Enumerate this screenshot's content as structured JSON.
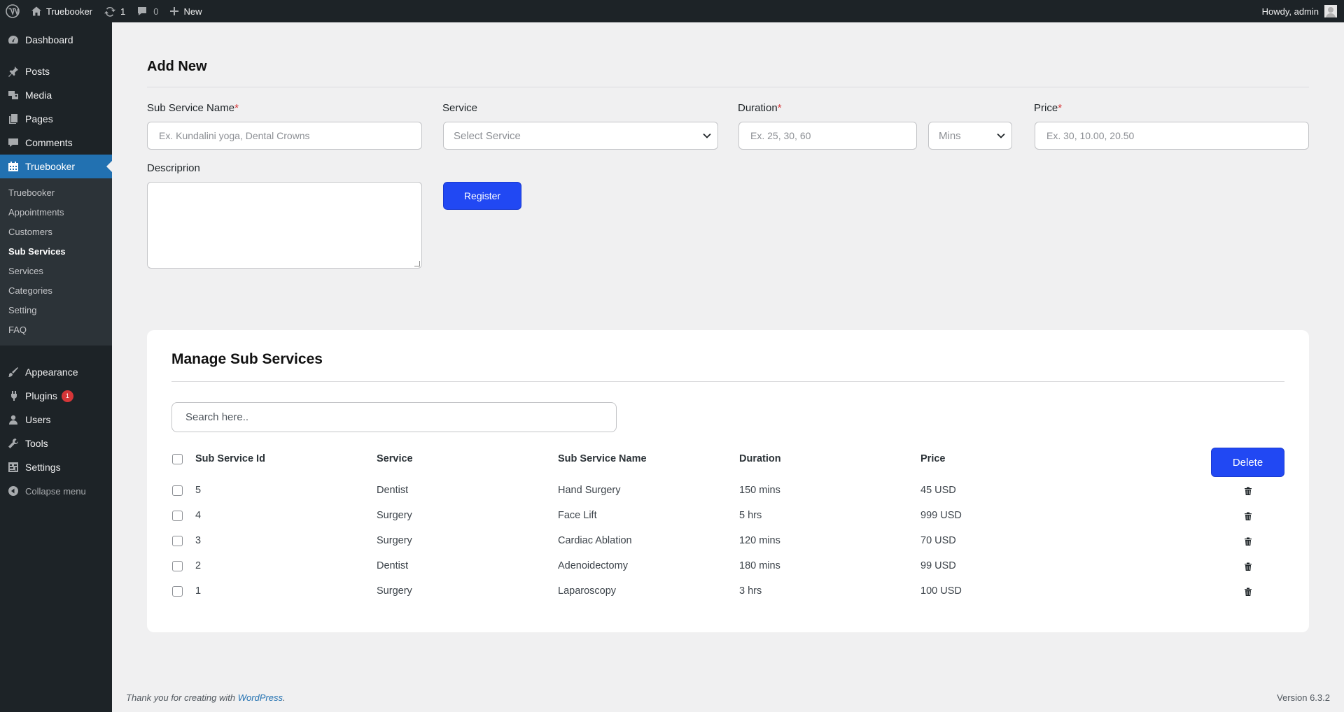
{
  "adminbar": {
    "site_name": "Truebooker",
    "updates_count": "1",
    "comments_count": "0",
    "new_label": "New",
    "howdy": "Howdy, admin"
  },
  "sidebar": {
    "top_items": [
      {
        "label": "Dashboard",
        "icon": "dashboard-icon"
      }
    ],
    "items": [
      {
        "label": "Posts",
        "icon": "pin-icon"
      },
      {
        "label": "Media",
        "icon": "media-icon"
      },
      {
        "label": "Pages",
        "icon": "pages-icon"
      },
      {
        "label": "Comments",
        "icon": "comment-icon"
      },
      {
        "label": "Truebooker",
        "icon": "calendar-icon"
      }
    ],
    "submenu": [
      "Truebooker",
      "Appointments",
      "Customers",
      "Sub Services",
      "Services",
      "Categories",
      "Setting",
      "FAQ"
    ],
    "bottom_items": [
      {
        "label": "Appearance",
        "icon": "brush-icon"
      },
      {
        "label": "Plugins",
        "icon": "plugin-icon",
        "badge": "1"
      },
      {
        "label": "Users",
        "icon": "user-icon"
      },
      {
        "label": "Tools",
        "icon": "wrench-icon"
      },
      {
        "label": "Settings",
        "icon": "settings-icon"
      }
    ],
    "collapse_label": "Collapse menu"
  },
  "add_new": {
    "title": "Add New",
    "sub_service_name_label": "Sub Service Name",
    "sub_service_name_placeholder": "Ex. Kundalini yoga, Dental Crowns",
    "service_label": "Service",
    "service_value": "Select Service",
    "duration_label": "Duration",
    "duration_placeholder": "Ex. 25, 30, 60",
    "duration_unit": "Mins",
    "price_label": "Price",
    "price_placeholder": "Ex. 30, 10.00, 20.50",
    "description_label": "Descriprion",
    "register_label": "Register",
    "required_mark": "*"
  },
  "manage": {
    "title": "Manage Sub Services",
    "search_placeholder": "Search here..",
    "delete_label": "Delete",
    "columns": [
      "Sub Service Id",
      "Service",
      "Sub Service Name",
      "Duration",
      "Price"
    ],
    "rows": [
      {
        "id": "5",
        "service": "Dentist",
        "name": "Hand Surgery",
        "duration": "150 mins",
        "price": "45 USD"
      },
      {
        "id": "4",
        "service": "Surgery",
        "name": "Face Lift",
        "duration": "5 hrs",
        "price": "999 USD"
      },
      {
        "id": "3",
        "service": "Surgery",
        "name": "Cardiac Ablation",
        "duration": "120 mins",
        "price": "70 USD"
      },
      {
        "id": "2",
        "service": "Dentist",
        "name": "Adenoidectomy",
        "duration": "180 mins",
        "price": "99 USD"
      },
      {
        "id": "1",
        "service": "Surgery",
        "name": "Laparoscopy",
        "duration": "3 hrs",
        "price": "100 USD"
      }
    ]
  },
  "footer": {
    "thanks_prefix": "Thank you for creating with ",
    "wordpress_link": "WordPress",
    "thanks_suffix": ".",
    "version": "Version 6.3.2"
  },
  "colors": {
    "primary_button": "#2148f3",
    "sidebar_bg": "#1d2327",
    "active_menu": "#2271b1",
    "required": "#d63638"
  }
}
